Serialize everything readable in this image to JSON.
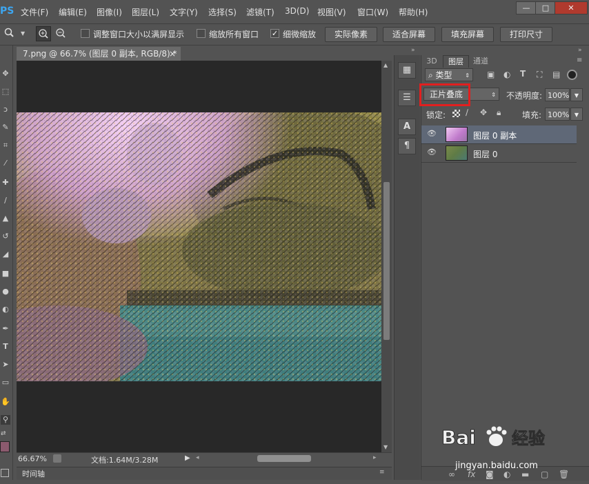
{
  "app": {
    "logo": "PS"
  },
  "menu": [
    "文件(F)",
    "编辑(E)",
    "图像(I)",
    "图层(L)",
    "文字(Y)",
    "选择(S)",
    "滤镜(T)",
    "3D(D)",
    "视图(V)",
    "窗口(W)",
    "帮助(H)"
  ],
  "window_controls": {
    "minimize": "—",
    "maximize": "□",
    "close": "✕"
  },
  "options_bar": {
    "resize_windows": {
      "label": "调整窗口大小以满屏显示",
      "checked": false
    },
    "zoom_all": {
      "label": "缩放所有窗口",
      "checked": false
    },
    "scrubby_zoom": {
      "label": "细微缩放",
      "checked": true
    },
    "btn_actual_pixels": "实际像素",
    "btn_fit_screen": "适合屏幕",
    "btn_fill_screen": "填充屏幕",
    "btn_print_size": "打印尺寸"
  },
  "document": {
    "tab_title": "7.png @ 66.7% (图层 0 副本, RGB/8) *",
    "tab_close": "×"
  },
  "status": {
    "zoom": "66.67%",
    "doc_info": "文档:1.64M/3.28M"
  },
  "timeline": {
    "label": "时间轴"
  },
  "panel": {
    "tabs": [
      "3D",
      "图层",
      "通道"
    ],
    "active_tab": "图层",
    "filter_kind": "类型",
    "blend_mode": "正片叠底",
    "opacity_label": "不透明度:",
    "opacity_value": "100%",
    "lock_label": "锁定:",
    "fill_label": "填充:",
    "fill_value": "100%",
    "layers": [
      {
        "name": "图层 0 副本",
        "selected": true,
        "thumb_color": "#d79fe0"
      },
      {
        "name": "图层 0",
        "selected": false,
        "thumb_color": "#6b7f45"
      }
    ]
  },
  "watermark": {
    "brand": "Baidu经验",
    "url": "jingyan.baidu.com"
  },
  "colors": {
    "accent_highlight": "#e21f1f",
    "selected_layer": "#5f6877"
  }
}
